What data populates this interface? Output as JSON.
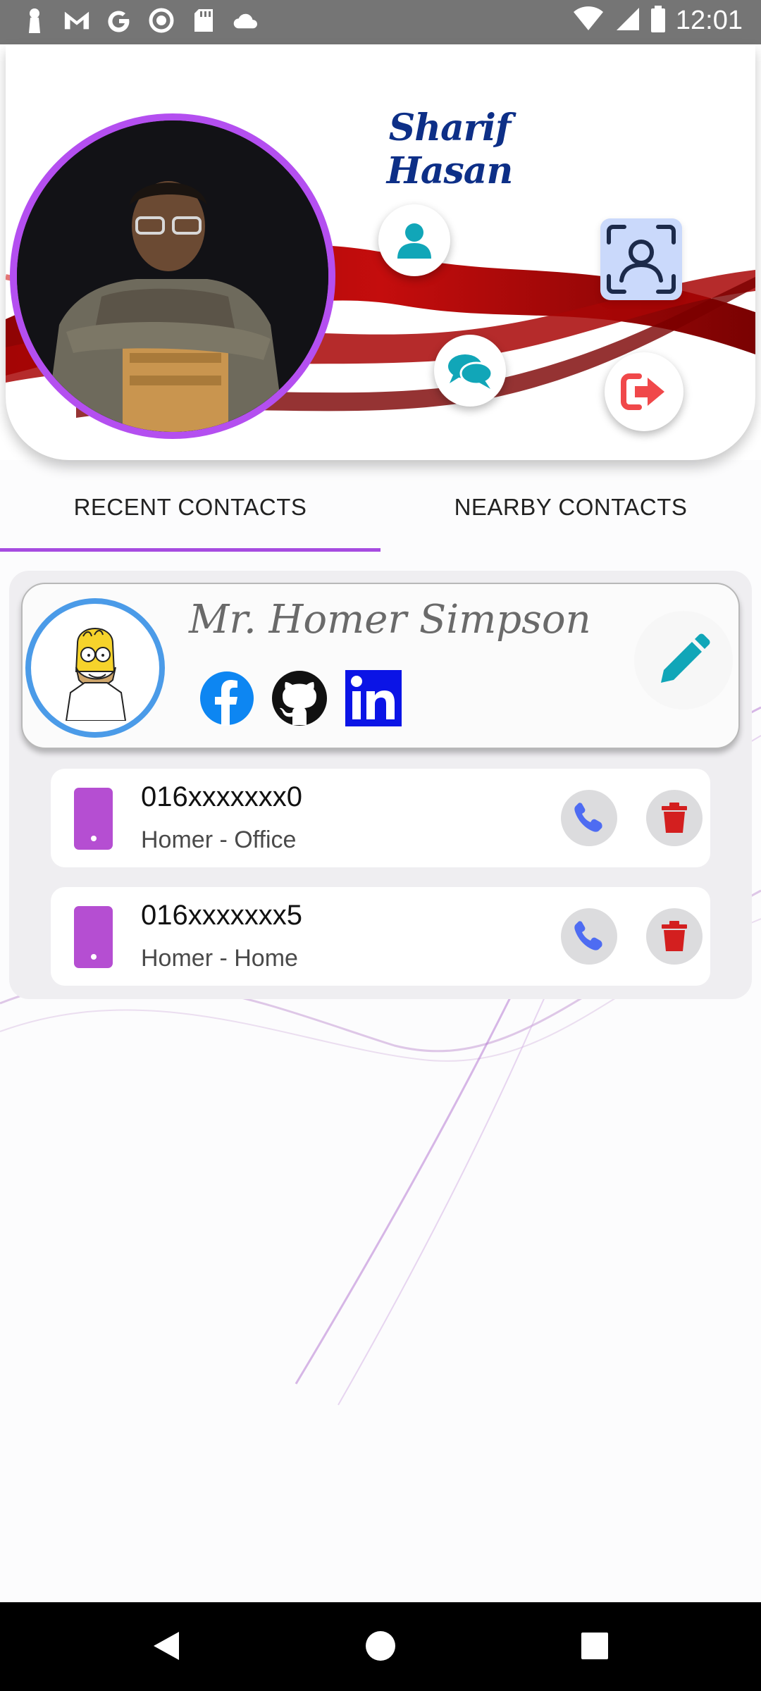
{
  "status_bar": {
    "time": "12:01",
    "icons": [
      "keyhole-icon",
      "gmail-icon",
      "google-icon",
      "circle-notification-icon",
      "sd-card-icon",
      "cloud-icon",
      "wifi-icon",
      "signal-icon",
      "battery-icon"
    ]
  },
  "header": {
    "user_name": "Sharif Hasan",
    "buttons": [
      "profile-person-icon",
      "qr-scan-icon",
      "chat-icon",
      "logout-icon"
    ]
  },
  "tabs": [
    {
      "label": "RECENT CONTACTS",
      "selected": true
    },
    {
      "label": "NEARBY CONTACTS",
      "selected": false
    }
  ],
  "contact": {
    "name": "Mr. Homer Simpson",
    "socials": [
      "facebook-icon",
      "github-icon",
      "linkedin-icon"
    ],
    "phones": [
      {
        "number": "016xxxxxxx0",
        "label": "Homer - Office"
      },
      {
        "number": "016xxxxxxx5",
        "label": "Homer - Home"
      }
    ]
  },
  "colors": {
    "accent_purple": "#a64be0",
    "avatar_border_blue": "#4b9be8",
    "name_navy": "#0d2f87",
    "wave_red": "#b20808",
    "phone_icon_purple": "#b54ed2",
    "call_blue": "#4e6cf2",
    "delete_red": "#d31f1f",
    "teal_icon": "#11a6b8"
  }
}
